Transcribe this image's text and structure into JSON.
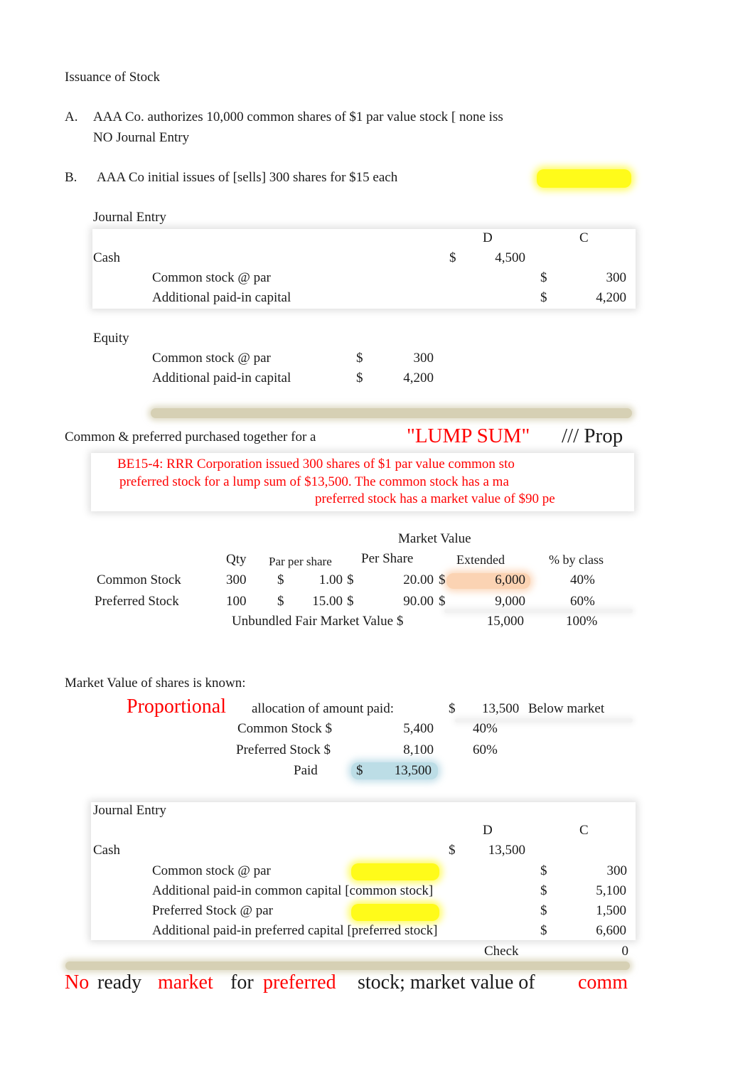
{
  "title": "Issuance of Stock",
  "section_a": {
    "label": "A.",
    "text": "AAA Co. authorizes 10,000 common shares of $1 par value stock [ none iss",
    "note": "NO Journal Entry"
  },
  "section_b": {
    "label": "B.",
    "text": "AAA Co initial issues of [sells] 300 shares for $15 each",
    "journal": {
      "title": "Journal Entry",
      "debit_header": "D",
      "credit_header": "C",
      "rows": [
        {
          "account": "Cash",
          "side": "D",
          "currency": "$",
          "amount": "4,500"
        },
        {
          "account": "Common stock @ par",
          "side": "C",
          "currency": "$",
          "amount": "300"
        },
        {
          "account": "Additional paid-in capital",
          "side": "C",
          "currency": "$",
          "amount": "4,200"
        }
      ]
    },
    "equity": {
      "title": "Equity",
      "rows": [
        {
          "account": "Common stock @ par",
          "currency": "$",
          "amount": "300"
        },
        {
          "account": "Additional paid-in capital",
          "currency": "$",
          "amount": "4,200"
        }
      ]
    }
  },
  "lump_sum": {
    "intro": "Common & preferred purchased together for a",
    "highlight": "\"LUMP SUM\"",
    "suffix": "/// Prop",
    "problem_lines": [
      "BE15-4: RRR Corporation issued 300 shares of $1 par value common sto",
      "preferred stock for a lump sum of $13,500. The common stock has a ma",
      "preferred stock has a market value of $90 pe"
    ]
  },
  "market_table": {
    "group_header": "Market Value",
    "headers": [
      "Qty",
      "Par per share",
      "Per Share",
      "Extended",
      "% by class"
    ],
    "rows": [
      {
        "label": "Common Stock",
        "qty": "300",
        "par_cur": "$",
        "par": "1.00",
        "ps_cur": "$",
        "per_share": "20.00",
        "ext_cur": "$",
        "extended": "6,000",
        "pct": "40%"
      },
      {
        "label": "Preferred Stock",
        "qty": "100",
        "par_cur": "$",
        "par": "15.00",
        "ps_cur": "$",
        "per_share": "90.00",
        "ext_cur": "$",
        "extended": "9,000",
        "pct": "60%"
      }
    ],
    "total_label": "Unbundled Fair Market Value $",
    "total": "15,000",
    "total_pct": "100%"
  },
  "allocation": {
    "heading": "Market Value of shares is known:",
    "method": "Proportional",
    "label": "allocation of amount paid:",
    "currency": "$",
    "amount": "13,500",
    "note": "Below market",
    "rows": [
      {
        "label": "Common Stock $",
        "amount": "5,400",
        "pct": "40%"
      },
      {
        "label": "Preferred Stock $",
        "amount": "8,100",
        "pct": "60%"
      }
    ],
    "paid_label": "Paid",
    "paid_currency": "$",
    "paid_amount": "13,500"
  },
  "journal_2": {
    "title": "Journal Entry",
    "debit_header": "D",
    "credit_header": "C",
    "rows": [
      {
        "account": "Cash",
        "side": "D",
        "currency": "$",
        "amount": "13,500"
      },
      {
        "account": "Common stock @ par",
        "side": "C",
        "currency": "$",
        "amount": "300"
      },
      {
        "account": "Additional paid-in common capital [common stock]",
        "side": "C",
        "currency": "$",
        "amount": "5,100"
      },
      {
        "account": "Preferred Stock @ par",
        "side": "C",
        "currency": "$",
        "amount": "1,500"
      },
      {
        "account": "Additional paid-in preferred capital [preferred stock]",
        "side": "C",
        "currency": "$",
        "amount": "6,600"
      }
    ],
    "check_label": "Check",
    "check_value": "0"
  },
  "footer": {
    "words": [
      {
        "text": "No",
        "color": "red"
      },
      {
        "text": "ready",
        "color": "black"
      },
      {
        "text": "market",
        "color": "red"
      },
      {
        "text": "for",
        "color": "black"
      },
      {
        "text": "preferred",
        "color": "red"
      },
      {
        "text": "stock; market value of",
        "color": "black"
      },
      {
        "text": "comm",
        "color": "red"
      }
    ]
  },
  "colors": {
    "red_text": "#ff0000",
    "yellow_highlight": "#fffb1a",
    "orange_highlight": "#fbd3b3",
    "blue_highlight": "#bcdde6",
    "tan_bar": "#d6d0b4"
  }
}
